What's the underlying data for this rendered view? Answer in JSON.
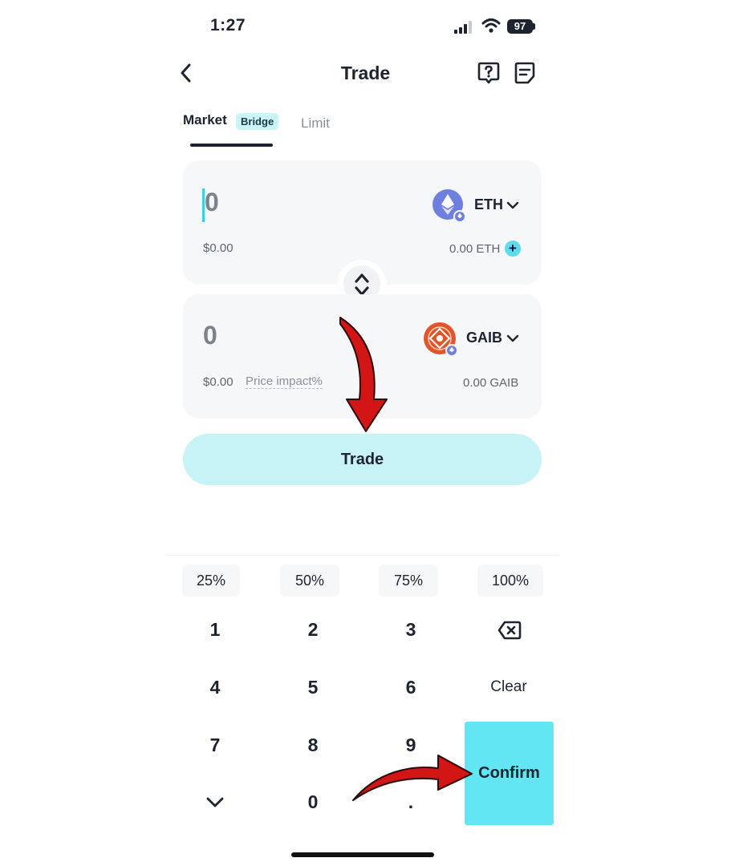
{
  "status_bar": {
    "time": "1:27",
    "battery": "97"
  },
  "header": {
    "title": "Trade"
  },
  "tabs": {
    "market": "Market",
    "bridge_badge": "Bridge",
    "limit": "Limit"
  },
  "from": {
    "amount": "0",
    "usd": "$0.00",
    "token": "ETH",
    "balance": "0.00 ETH"
  },
  "to": {
    "amount": "0",
    "usd": "$0.00",
    "price_impact": "Price impact%",
    "token": "GAIB",
    "balance": "0.00 GAIB"
  },
  "trade_button": "Trade",
  "percent_buttons": [
    "25%",
    "50%",
    "75%",
    "100%"
  ],
  "keypad": {
    "k1": "1",
    "k2": "2",
    "k3": "3",
    "k4": "4",
    "k5": "5",
    "k6": "6",
    "clear": "Clear",
    "k7": "7",
    "k8": "8",
    "k9": "9",
    "k0": "0",
    "dot": ".",
    "confirm": "Confirm"
  },
  "colors": {
    "accent": "#63e6f4",
    "trade_button": "#c7f3f7",
    "eth": "#6f7fe0",
    "gaib": "#e0562a",
    "annotation_arrow": "#d31515"
  }
}
